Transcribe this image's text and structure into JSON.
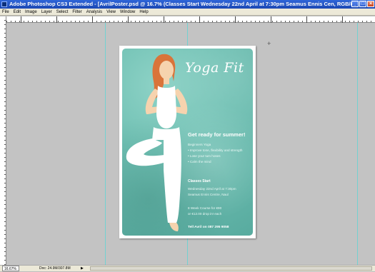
{
  "window": {
    "title": "Adobe Photoshop CS3 Extended - [AvrilPoster.psd @ 16.7% (Classes Start  Wednesday 22nd April at 7:30pm  Seamus Ennis Cen, RGB/8)]",
    "buttons": {
      "minimize": "_",
      "maximize": "□",
      "close": "×"
    }
  },
  "menu": {
    "items": [
      "File",
      "Edit",
      "Image",
      "Layer",
      "Select",
      "Filter",
      "Analysis",
      "View",
      "Window",
      "Help"
    ]
  },
  "poster": {
    "title": "Yoga Fit",
    "headline": "Get ready for summer!",
    "bullets": [
      "Beginners Yoga",
      "• Improve tone, flexibility and strength",
      "• Lose your tum hoses",
      "• Calm the mind"
    ],
    "subheading": "Classes Start",
    "details": [
      "Wednesday 22nd April at 7:30pm",
      "Seamus Ennis Centre, Naul"
    ],
    "course": [
      "8 Week Course for €90",
      "or €12.00 drop in! each"
    ],
    "contact": "Tell Avril on 087 295 9058",
    "colors": {
      "background": "#6fc0b3",
      "text": "#ffffff",
      "hair": "#d9743a"
    }
  },
  "status": {
    "zoom": "16.67%",
    "doc": "Doc: 24.9M/307.8M",
    "arrow": "▶"
  }
}
